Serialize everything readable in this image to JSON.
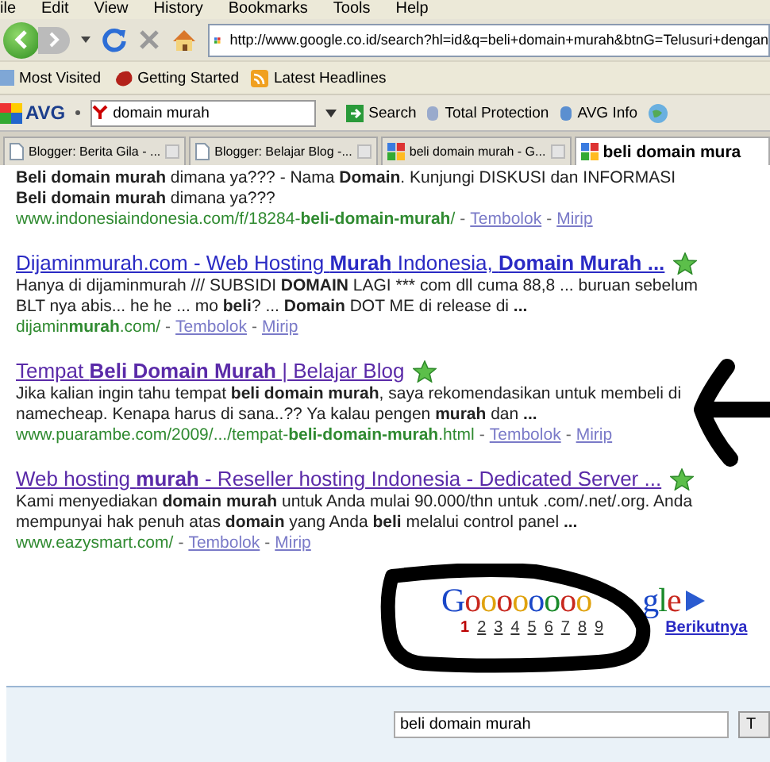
{
  "menu": [
    "ile",
    "Edit",
    "View",
    "History",
    "Bookmarks",
    "Tools",
    "Help"
  ],
  "address": {
    "value": "http://www.google.co.id/search?hl=id&q=beli+domain+murah&btnG=Telusuri+dengan"
  },
  "bookmarks": [
    "Most Visited",
    "Getting Started",
    "Latest Headlines"
  ],
  "toolbar": {
    "brand": "AVG",
    "search_value": "domain murah",
    "search_button": "Search",
    "items": [
      "Total Protection",
      "AVG Info"
    ]
  },
  "tabs": [
    {
      "label": "Blogger: Berita Gila - ...",
      "kind": "page",
      "selected": false
    },
    {
      "label": "Blogger: Belajar Blog -...",
      "kind": "page",
      "selected": false
    },
    {
      "label": "beli domain murah - G...",
      "kind": "google",
      "selected": false
    },
    {
      "label": "beli domain mura",
      "kind": "google",
      "selected": true
    }
  ],
  "results": [
    {
      "snippet": [
        "**Beli domain murah** dimana ya??? - Nama **Domain**. Kunjungi DISKUSI dan INFORMASI",
        "**Beli domain murah** dimana ya???"
      ],
      "url": "www.indonesiaindonesia.com/f/18284-**beli-domain-murah**/",
      "sep": "-",
      "cache": "Tembolok",
      "similar": "Mirip"
    },
    {
      "title": "Dijaminmurah.com - Web Hosting **Murah** Indonesia, **Domain Murah ...**",
      "visited": false,
      "snippet": [
        "Hanya di dijaminmurah /// SUBSIDI **DOMAIN** LAGI *** com dll cuma 88,8 ... buruan sebelum",
        "BLT nya abis... he he ... mo **beli**? ... **Domain** DOT ME di release di **...**"
      ],
      "url": "dijamin**murah**.com/",
      "sep": "-",
      "cache": "Tembolok",
      "similar": "Mirip"
    },
    {
      "title": "Tempat **Beli Domain Murah** | Belajar Blog",
      "visited": true,
      "snippet": [
        "Jika kalian ingin tahu tempat **beli domain murah**, saya rekomendasikan untuk membeli di",
        "namecheap. Kenapa harus di sana..?? Ya kalau pengen **murah** dan **...**"
      ],
      "url": "www.puarambe.com/2009/.../tempat-**beli-domain-murah**.html",
      "sep": "-",
      "cache": "Tembolok",
      "similar": "Mirip"
    },
    {
      "title": "Web hosting **murah** - Reseller hosting Indonesia - Dedicated Server ...",
      "visited": true,
      "snippet": [
        "Kami menyediakan **domain murah** untuk Anda mulai 90.000/thn untuk .com/.net/.org. Anda",
        "mempunyai hak penuh atas **domain** yang Anda **beli** melalui control panel **...**"
      ],
      "url": "www.eazysmart.com/",
      "sep": "-",
      "cache": "Tembolok",
      "similar": "Mirip"
    }
  ],
  "pager": {
    "logo_start": "Goooooooo",
    "logo_end": "gle",
    "pages": [
      {
        "label": "1",
        "selected": true
      },
      {
        "label": "2",
        "selected": false
      },
      {
        "label": "3",
        "selected": false
      },
      {
        "label": "4",
        "selected": false
      },
      {
        "label": "5",
        "selected": false
      },
      {
        "label": "6",
        "selected": false
      },
      {
        "label": "7",
        "selected": false
      },
      {
        "label": "8",
        "selected": false
      },
      {
        "label": "9",
        "selected": false
      }
    ],
    "next": "Berikutnya"
  },
  "bottom_search": {
    "value": "beli domain murah",
    "button": "T"
  }
}
